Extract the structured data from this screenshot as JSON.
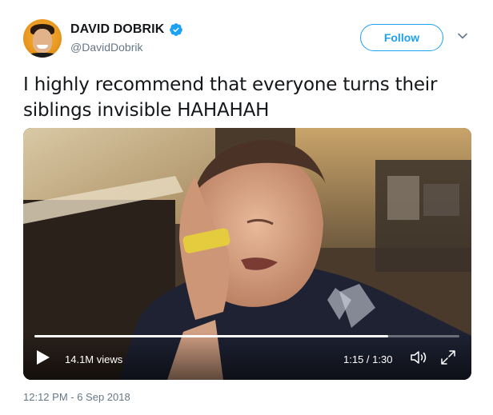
{
  "user": {
    "display_name": "DAVID DOBRIK",
    "handle": "@DavidDobrik",
    "verified": true
  },
  "actions": {
    "follow_label": "Follow"
  },
  "tweet": {
    "text": "I highly recommend that everyone turns their siblings invisible HAHAHAH",
    "timestamp": "12:12 PM - 6 Sep 2018"
  },
  "video": {
    "views": "14.1M views",
    "time": "1:15 / 1:30",
    "progress": 0.833
  },
  "colors": {
    "accent": "#1da1f2",
    "secondary_text": "#657786"
  },
  "icons": {
    "verified": "verified-badge-icon",
    "caret": "chevron-down-icon",
    "play": "play-icon",
    "volume": "volume-icon",
    "fullscreen": "fullscreen-icon"
  }
}
